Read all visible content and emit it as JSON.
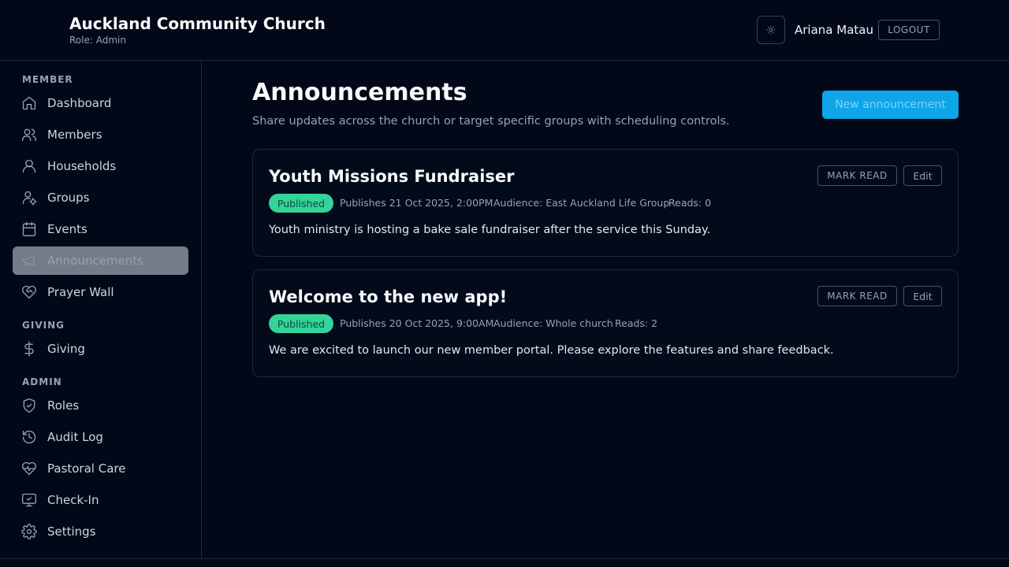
{
  "header": {
    "org_name": "Auckland Community Church",
    "role": "Role: Admin",
    "theme_icon": "sun-icon",
    "user_name": "Ariana Matau",
    "logout_label": "LOGOUT"
  },
  "sidebar": {
    "sections": [
      {
        "label": "MEMBER"
      },
      {
        "label": "GIVING"
      },
      {
        "label": "ADMIN"
      }
    ],
    "items": [
      {
        "label": "Dashboard",
        "icon": "home-icon"
      },
      {
        "label": "Members",
        "icon": "users-icon"
      },
      {
        "label": "Households",
        "icon": "user-icon"
      },
      {
        "label": "Groups",
        "icon": "user-cog-icon"
      },
      {
        "label": "Events",
        "icon": "calendar-icon"
      },
      {
        "label": "Announcements",
        "icon": "megaphone-icon",
        "active": true
      },
      {
        "label": "Prayer Wall",
        "icon": "heart-handshake-icon"
      },
      {
        "label": "Giving",
        "icon": "dollar-icon"
      },
      {
        "label": "Roles",
        "icon": "shield-check-icon"
      },
      {
        "label": "Audit Log",
        "icon": "history-icon"
      },
      {
        "label": "Pastoral Care",
        "icon": "heart-pulse-icon"
      },
      {
        "label": "Check-In",
        "icon": "monitor-check-icon"
      },
      {
        "label": "Settings",
        "icon": "gear-icon"
      }
    ]
  },
  "main": {
    "title": "Announcements",
    "subtitle": "Share updates across the church or target specific groups with scheduling controls.",
    "new_button_label": "New announcement",
    "announcements": [
      {
        "title": "Youth Missions Fundraiser",
        "status": "Published",
        "publishes": "Publishes 21 Oct 2025, 2:00PM",
        "audience": "Audience: East Auckland Life Group",
        "reads": "Reads: 0",
        "body": "Youth ministry is hosting a bake sale fundraiser after the service this Sunday.",
        "mark_read_label": "MARK READ",
        "edit_label": "Edit"
      },
      {
        "title": "Welcome to the new app!",
        "status": "Published",
        "publishes": "Publishes 20 Oct 2025, 9:00AM",
        "audience": "Audience: Whole church",
        "reads": "Reads: 2",
        "body": "We are excited to launch our new member portal. Please explore the features and share feedback.",
        "mark_read_label": "MARK READ",
        "edit_label": "Edit"
      }
    ]
  },
  "colors": {
    "background": "#020817",
    "accent": "#0ea5e9",
    "published_badge": "#34d399"
  }
}
